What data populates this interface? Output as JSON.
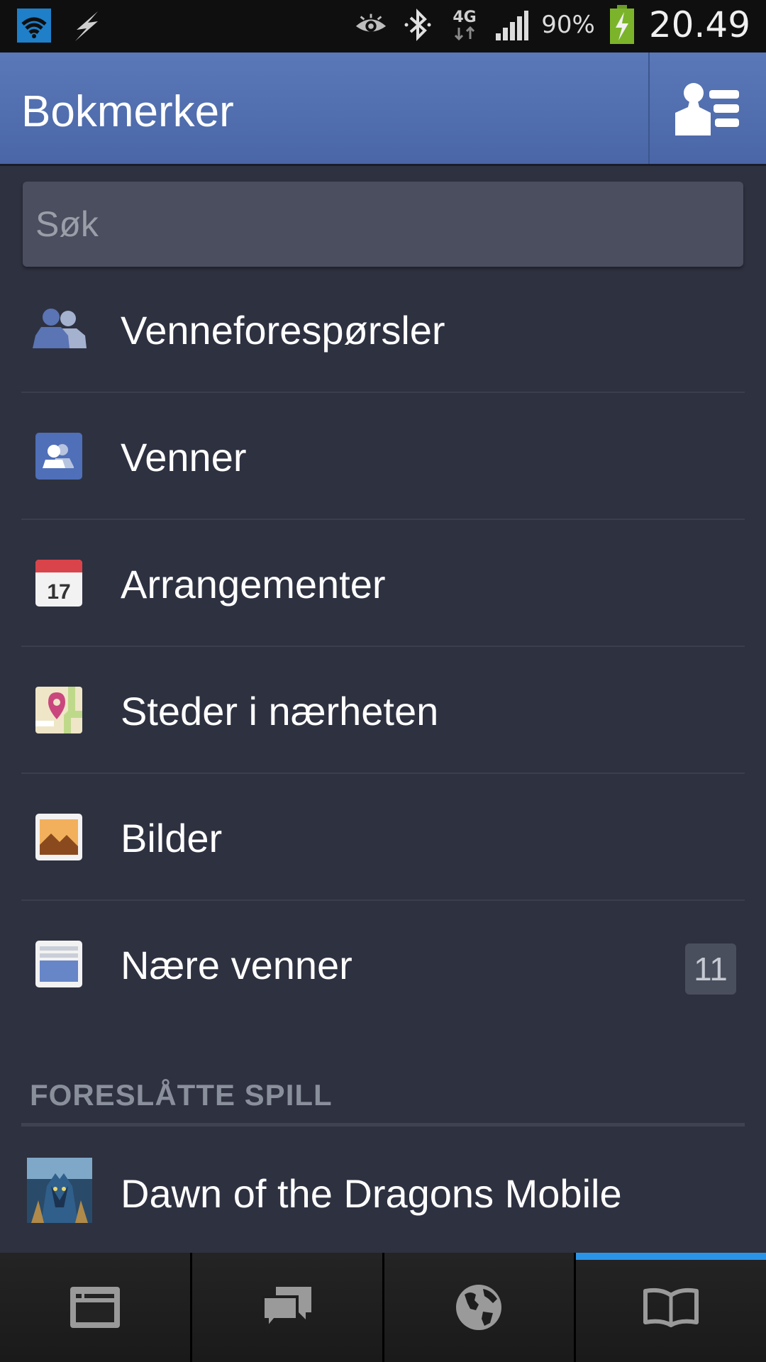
{
  "status_bar": {
    "battery_percent": "90%",
    "time": "20.49",
    "network": "4G",
    "icons": [
      "wifi-icon",
      "flash-icon",
      "eye-icon",
      "bluetooth-icon",
      "network-4g-icon",
      "signal-icon",
      "battery-charging-icon"
    ]
  },
  "app_bar": {
    "title": "Bokmerker",
    "friends_icon": "friends-list-icon"
  },
  "search": {
    "placeholder": "Søk"
  },
  "bookmarks": [
    {
      "label": "Venneforespørsler",
      "icon": "friend-requests-icon"
    },
    {
      "label": "Venner",
      "icon": "friends-icon"
    },
    {
      "label": "Arrangementer",
      "icon": "calendar-icon",
      "icon_text": "17"
    },
    {
      "label": "Steder i nærheten",
      "icon": "nearby-places-icon"
    },
    {
      "label": "Bilder",
      "icon": "photos-icon"
    },
    {
      "label": "Nære venner",
      "icon": "close-friends-list-icon",
      "badge": "11"
    }
  ],
  "suggested_games": {
    "header": "FORESLÅTTE SPILL",
    "items": [
      {
        "label": "Dawn of the Dragons Mobile",
        "icon": "game-thumbnail-icon"
      }
    ]
  },
  "tab_bar": {
    "tabs": [
      {
        "icon": "news-feed-icon",
        "active": false
      },
      {
        "icon": "messages-icon",
        "active": false
      },
      {
        "icon": "notifications-globe-icon",
        "active": false
      },
      {
        "icon": "bookmarks-book-icon",
        "active": true
      }
    ],
    "active_color": "#2a95e8"
  },
  "colors": {
    "app_bar": "#4a66a6",
    "background": "#2e3140",
    "search_field": "#4a4e5e"
  }
}
